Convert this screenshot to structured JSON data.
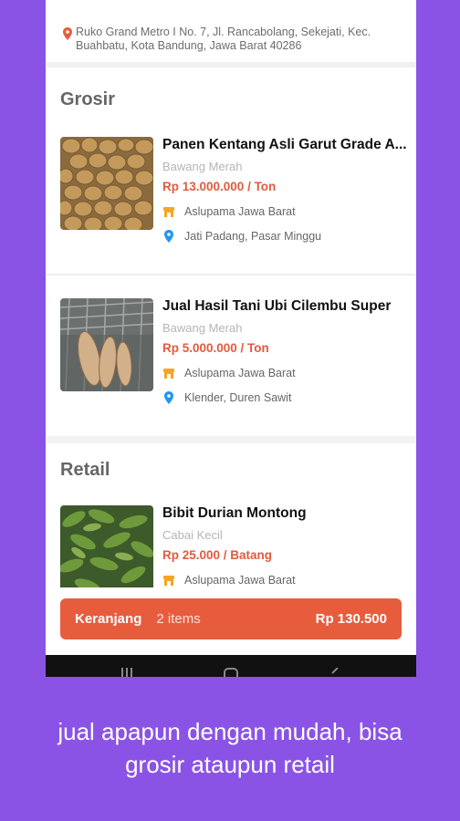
{
  "address": {
    "text": "Ruko Grand Metro I No. 7, Jl. Rancabolang, Sekejati, Kec. Buahbatu, Kota Bandung, Jawa Barat 40286"
  },
  "grosir": {
    "title": "Grosir",
    "products": [
      {
        "name": "Panen Kentang Asli Garut Grade A...",
        "category": "Bawang Merah",
        "price": "Rp 13.000.000 / Ton",
        "seller": "Aslupama Jawa Barat",
        "location": "Jati Padang, Pasar Minggu"
      },
      {
        "name": "Jual Hasil Tani Ubi Cilembu Super",
        "category": "Bawang Merah",
        "price": "Rp 5.000.000 / Ton",
        "seller": "Aslupama Jawa Barat",
        "location": "Klender, Duren Sawit"
      }
    ]
  },
  "retail": {
    "title": "Retail",
    "products": [
      {
        "name": "Bibit Durian Montong",
        "category": "Cabai Kecil",
        "price": "Rp 25.000 / Batang",
        "seller": "Aslupama Jawa Barat"
      }
    ]
  },
  "cart": {
    "label": "Keranjang",
    "count": "2 items",
    "total": "Rp 130.500"
  },
  "caption": {
    "line1": "jual apapun dengan mudah, bisa",
    "line2": "grosir ataupun retail"
  },
  "colors": {
    "background": "#8a53e6",
    "price": "#e35a3c",
    "cart": "#e85c3e",
    "store_icon": "#f5a623",
    "pin_icon": "#2196f3"
  },
  "icons": {
    "address": "location-pin-icon",
    "seller": "store-icon",
    "location": "location-pin-icon"
  }
}
